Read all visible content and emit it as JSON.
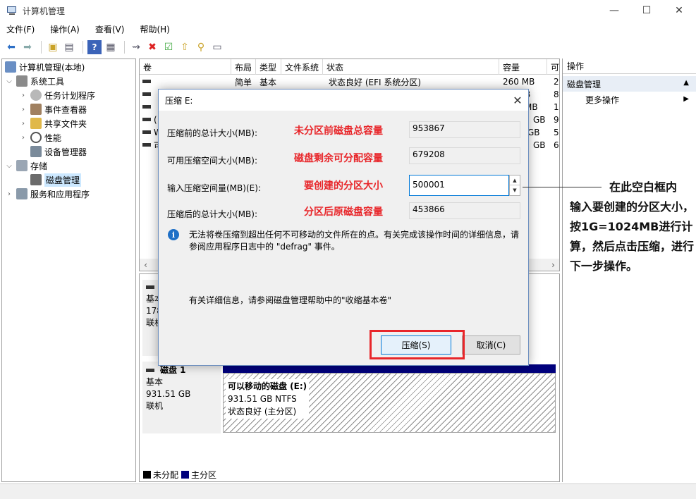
{
  "window": {
    "title": "计算机管理",
    "minimize": "—",
    "maximize": "☐",
    "close": "✕"
  },
  "menu": [
    "文件(F)",
    "操作(A)",
    "查看(V)",
    "帮助(H)"
  ],
  "tree": {
    "root": "计算机管理(本地)",
    "system_tools": "系统工具",
    "task_scheduler": "任务计划程序",
    "event_viewer": "事件查看器",
    "shared_folders": "共享文件夹",
    "performance": "性能",
    "device_manager": "设备管理器",
    "storage": "存储",
    "disk_management": "磁盘管理",
    "services": "服务和应用程序"
  },
  "volume_list": {
    "columns": [
      "卷",
      "布局",
      "类型",
      "文件系统",
      "状态",
      "容量",
      "可"
    ],
    "rows": [
      {
        "layout": "简单",
        "type": "基本",
        "fs": "",
        "status": "状态良好 (EFI 系统分区)",
        "capacity": "260 MB",
        "free": "2"
      },
      {
        "layout": "",
        "type": "",
        "fs": "",
        "status": "",
        "capacity": "B",
        "free": "8"
      },
      {
        "layout": "",
        "type": "",
        "fs": "",
        "status": "",
        "capacity": "MB",
        "free": "1"
      },
      {
        "layout": "",
        "type": "",
        "fs": "",
        "status": "",
        "capacity": "GB",
        "free": "9"
      },
      {
        "layout": "",
        "type": "",
        "fs": "",
        "status": "",
        "capacity": "GB",
        "free": "5"
      },
      {
        "layout": "",
        "type": "",
        "fs": "",
        "status": "",
        "capacity": "GB",
        "free": "6"
      }
    ],
    "row_prefixes": [
      "",
      "",
      "",
      "(",
      "W",
      "可"
    ]
  },
  "disk0": {
    "type_short": "基本",
    "size_short": "178",
    "status_short": "联机"
  },
  "disk1": {
    "name": "磁盘 1",
    "type": "基本",
    "size": "931.51 GB",
    "status": "联机",
    "partition_name": "可以移动的磁盘 (E:)",
    "partition_size": "931.51 GB NTFS",
    "partition_status": "状态良好 (主分区)"
  },
  "legend": {
    "unallocated": "未分配",
    "primary": "主分区"
  },
  "actions": {
    "header": "操作",
    "section": "磁盘管理",
    "more": "更多操作"
  },
  "dialog": {
    "title": "压缩 E:",
    "total_before_label": "压缩前的总计大小(MB):",
    "total_before_value": "953867",
    "available_label": "可用压缩空间大小(MB):",
    "available_value": "679208",
    "input_label": "输入压缩空间量(MB)(E):",
    "input_value": "500001",
    "total_after_label": "压缩后的总计大小(MB):",
    "total_after_value": "453866",
    "info_text": "无法将卷压缩到超出任何不可移动的文件所在的点。有关完成该操作时间的详细信息，请参阅应用程序日志中的 \"defrag\" 事件。",
    "help_text": "有关详细信息，请参阅磁盘管理帮助中的\"收缩基本卷\"",
    "shrink_button": "压缩(S)",
    "cancel_button": "取消(C)"
  },
  "annotations": {
    "note_before": "未分区前磁盘总容量",
    "note_available": "磁盘剩余可分配容量",
    "note_input": "要创建的分区大小",
    "note_after": "分区后原磁盘容量",
    "callout_line1": "在此空白框内",
    "callout_rest": "输入要创建的分区大小，按1G=1024MB进行计算，然后点击压缩，进行下一步操作。"
  },
  "colors": {
    "primary_partition": "#00007c",
    "unallocated": "#000000",
    "annotation_red": "#e8262a",
    "accent_blue": "#0078d7"
  }
}
